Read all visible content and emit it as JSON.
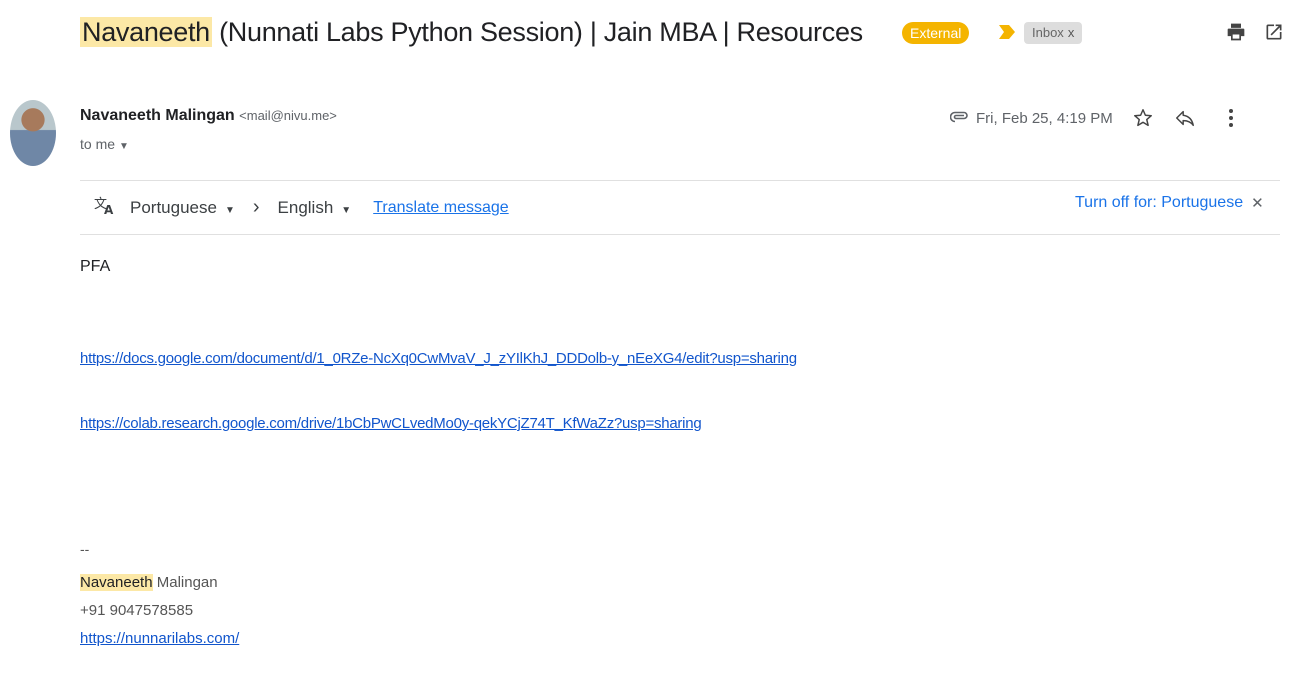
{
  "subject": {
    "highlight": "Navaneeth",
    "rest": " (Nunnati Labs Python Session) | Jain MBA | Resources",
    "labels": {
      "external": "External",
      "inbox": "Inbox",
      "inbox_remove": "x"
    }
  },
  "colors": {
    "external_badge": "#f4b400",
    "important_marker": "#f4b400",
    "link": "#1155cc",
    "highlight": "#fce8a6"
  },
  "icons": {
    "print": "printer-icon",
    "open_new": "open-in-new-window-icon",
    "attachment": "paperclip-icon",
    "star": "star-icon",
    "reply": "reply-icon",
    "more": "more-vert-icon",
    "translate": "translate-icon"
  },
  "sender": {
    "name": "Navaneeth Malingan",
    "email": "<mail@nivu.me>",
    "to": "to me"
  },
  "date": "Fri, Feb 25, 4:19 PM",
  "translate": {
    "from": "Portuguese",
    "to": "English",
    "action": "Translate message",
    "turn_off": "Turn off for: Portuguese"
  },
  "body": {
    "greeting": "PFA",
    "links": [
      "https://docs.google.com/document/d/1_0RZe-NcXq0CwMvaV_J_zYIlKhJ_DDDolb-y_nEeXG4/edit?usp=sharing",
      "https://colab.research.google.com/drive/1bCbPwCLvedMo0y-qekYCjZ74T_KfWaZz?usp=sharing"
    ],
    "signature": {
      "dashes": "--",
      "first_name": "Navaneeth",
      "last_name": " Malingan",
      "phone": "+91 9047578585",
      "website": "https://nunnarilabs.com/"
    }
  }
}
